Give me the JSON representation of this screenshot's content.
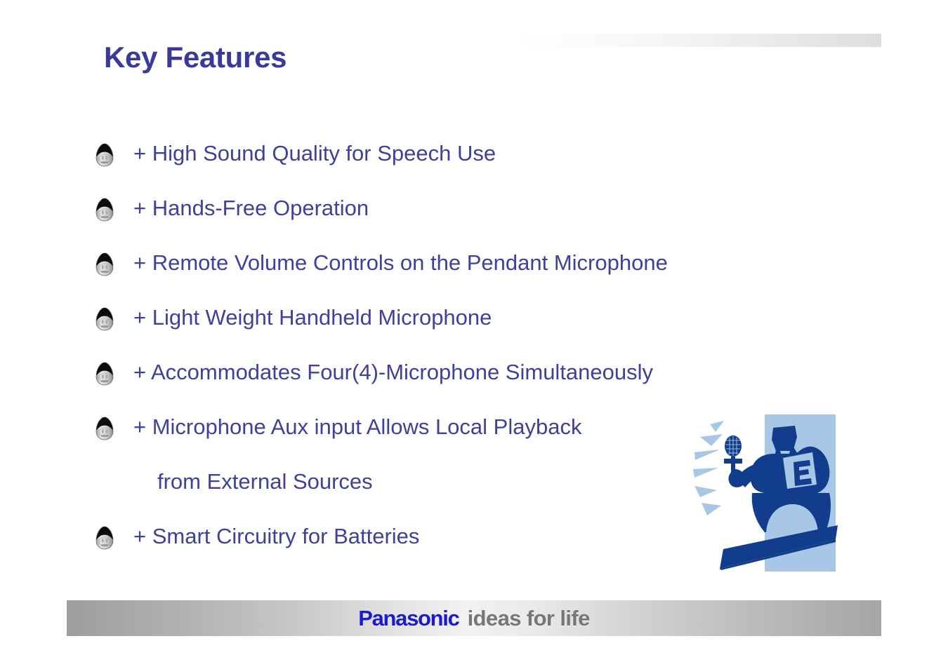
{
  "slide": {
    "title": "Key Features",
    "title_color": "#3a3a9e",
    "body_color": "#3f3f9e",
    "background_color": "#ffffff"
  },
  "features": [
    {
      "bullet": true,
      "text": "+ High Sound Quality for Speech Use"
    },
    {
      "bullet": true,
      "text": "+ Hands-Free Operation"
    },
    {
      "bullet": true,
      "text": "+ Remote Volume Controls on the Pendant Microphone"
    },
    {
      "bullet": true,
      "text": "+ Light Weight Handheld Microphone"
    },
    {
      "bullet": true,
      "text": "+ Accommodates Four(4)-Microphone Simultaneously"
    },
    {
      "bullet": true,
      "text": "+ Microphone Aux input Allows Local Playback"
    },
    {
      "bullet": false,
      "text": "from External Sources"
    },
    {
      "bullet": true,
      "text": "+ Smart Circuitry for Batteries"
    }
  ],
  "bullet_icon": {
    "name": "pendant-microphone-icon",
    "dome_color": "#0b0b0f",
    "body_color": "#cfcfcf"
  },
  "clipart": {
    "name": "speaker-with-microphone-illustration",
    "dark_blue": "#123c8c",
    "light_blue": "#a8c6e6",
    "sound_wave_count": 6
  },
  "footer": {
    "brand": "Panasonic",
    "tagline": "ideas for life",
    "brand_color": "#1a1ad0",
    "tagline_color": "#777777"
  }
}
